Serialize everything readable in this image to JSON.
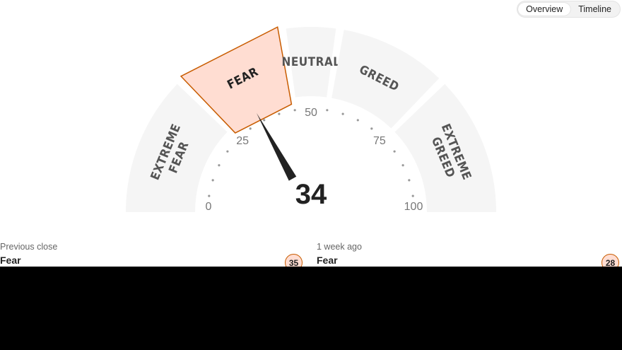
{
  "toggle": {
    "options": [
      "Overview",
      "Timeline"
    ],
    "active": "Overview"
  },
  "chart_data": {
    "type": "gauge",
    "value": 34,
    "min": 0,
    "max": 100,
    "ticks": [
      0,
      25,
      50,
      75,
      100
    ],
    "segments": [
      {
        "label": "EXTREME FEAR",
        "from": 0,
        "to": 25
      },
      {
        "label": "FEAR",
        "from": 25,
        "to": 45
      },
      {
        "label": "NEUTRAL",
        "from": 45,
        "to": 55
      },
      {
        "label": "GREED",
        "from": 55,
        "to": 75
      },
      {
        "label": "EXTREME GREED",
        "from": 75,
        "to": 100
      }
    ],
    "active_segment": "FEAR",
    "colors": {
      "segment": "#f5f5f5",
      "active_fill": "#ffddd2",
      "active_stroke": "#c85c00",
      "needle": "#222222"
    }
  },
  "history": [
    {
      "caption": "Previous close",
      "label": "Fear",
      "value": 35
    },
    {
      "caption": "1 week ago",
      "label": "Fear",
      "value": 28
    }
  ]
}
